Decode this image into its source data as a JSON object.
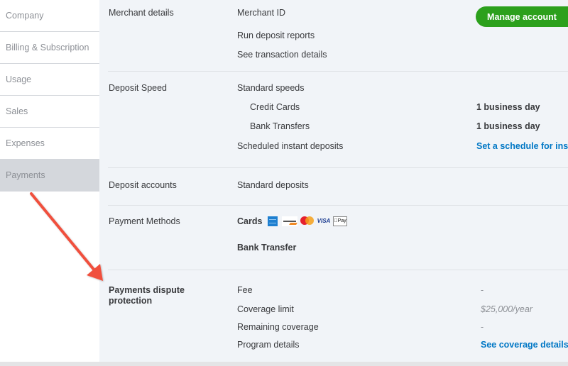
{
  "sidebar": {
    "items": [
      {
        "label": "Company",
        "active": false
      },
      {
        "label": "Billing & Subscription",
        "active": false
      },
      {
        "label": "Usage",
        "active": false
      },
      {
        "label": "Sales",
        "active": false
      },
      {
        "label": "Expenses",
        "active": false
      },
      {
        "label": "Payments",
        "active": true
      }
    ]
  },
  "merchant_details": {
    "title": "Merchant details",
    "merchant_id_label": "Merchant ID",
    "run_reports_label": "Run deposit reports",
    "transaction_details_label": "See transaction details",
    "manage_button": "Manage account"
  },
  "deposit_speed": {
    "title": "Deposit Speed",
    "standard_label": "Standard speeds",
    "credit_cards_label": "Credit Cards",
    "credit_cards_value": "1 business day",
    "bank_transfers_label": "Bank Transfers",
    "bank_transfers_value": "1 business day",
    "scheduled_label": "Scheduled instant deposits",
    "scheduled_link": "Set a schedule for insta"
  },
  "deposit_accounts": {
    "title": "Deposit accounts",
    "standard_label": "Standard deposits"
  },
  "payment_methods": {
    "title": "Payment Methods",
    "cards_label": "Cards",
    "card_brands": [
      "amex-icon",
      "discover-icon",
      "mastercard-icon",
      "visa-icon",
      "apple-pay-icon"
    ],
    "visa_text": "VISA",
    "applepay_text": "Pay",
    "bank_transfer_label": "Bank Transfer"
  },
  "dispute_protection": {
    "title_line1": "Payments dispute",
    "title_line2": "protection",
    "fee_label": "Fee",
    "fee_value": "-",
    "coverage_limit_label": "Coverage limit",
    "coverage_limit_value": "$25,000/year",
    "remaining_label": "Remaining coverage",
    "remaining_value": "-",
    "program_label": "Program details",
    "program_link": "See coverage details"
  },
  "colors": {
    "accent_green": "#2ca01c",
    "link_blue": "#0077c5",
    "annotation_arrow": "#f0503c"
  }
}
